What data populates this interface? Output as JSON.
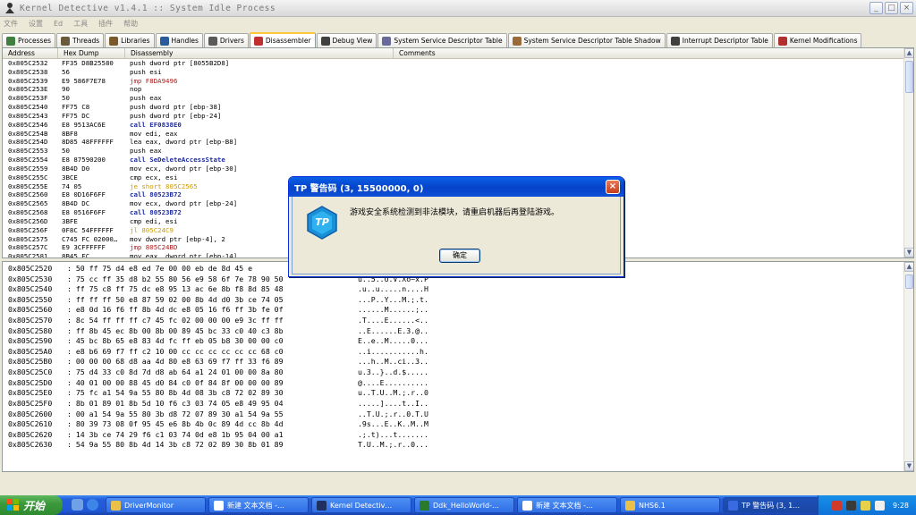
{
  "window": {
    "title": "Kernel Detective v1.4.1 :: System Idle Process",
    "controls": [
      "_",
      "□",
      "×"
    ]
  },
  "menu": [
    "文件",
    "设置",
    "Ed",
    "工具",
    "插件",
    "帮助"
  ],
  "tabs": [
    {
      "label": "Processes",
      "icon": "gear-icon",
      "color": "#3f7f3f"
    },
    {
      "label": "Threads",
      "icon": "threads-icon",
      "color": "#6b5a3a"
    },
    {
      "label": "Libraries",
      "icon": "library-icon",
      "color": "#7a5a2a"
    },
    {
      "label": "Handles",
      "icon": "handles-icon",
      "color": "#2a5a9a"
    },
    {
      "label": "Drivers",
      "icon": "driver-icon",
      "color": "#5a5a5a"
    },
    {
      "label": "Disassembler",
      "icon": "disassembler-icon",
      "color": "#c03030",
      "active": true
    },
    {
      "label": "Debug View",
      "icon": "debug-icon",
      "color": "#404040"
    },
    {
      "label": "System Service Descriptor Table",
      "icon": "wrench-icon",
      "color": "#6a6a9a"
    },
    {
      "label": "System Service Descriptor Table Shadow",
      "icon": "wrench-icon",
      "color": "#9a6a3a"
    },
    {
      "label": "Interrupt Descriptor Table",
      "icon": "keyboard-icon",
      "color": "#404040"
    },
    {
      "label": "Kernel Modifications",
      "icon": "shield-icon",
      "color": "#b03030"
    }
  ],
  "disasm": {
    "headers": [
      "Address",
      "Hex Dump",
      "Disassembly",
      "Comments"
    ],
    "rows": [
      {
        "addr": "0x805C2532",
        "hex": "FF35 D8B25580",
        "dis": "push dword ptr [8055B2D8]",
        "kind": ""
      },
      {
        "addr": "0x805C2538",
        "hex": "56",
        "dis": "push esi",
        "kind": ""
      },
      {
        "addr": "0x805C2539",
        "hex": "E9 586F7E78",
        "dis": "jmp F8DA9496",
        "kind": "jmp"
      },
      {
        "addr": "0x805C253E",
        "hex": "90",
        "dis": "nop",
        "kind": ""
      },
      {
        "addr": "0x805C253F",
        "hex": "50",
        "dis": "push eax",
        "kind": ""
      },
      {
        "addr": "0x805C2540",
        "hex": "FF75 C8",
        "dis": "push dword ptr [ebp-38]",
        "kind": ""
      },
      {
        "addr": "0x805C2543",
        "hex": "FF75 DC",
        "dis": "push dword ptr [ebp-24]",
        "kind": ""
      },
      {
        "addr": "0x805C2546",
        "hex": "E8 9513AC6E",
        "dis": "call EF0838E0",
        "kind": "call"
      },
      {
        "addr": "0x805C254B",
        "hex": "8BF8",
        "dis": "mov edi, eax",
        "kind": ""
      },
      {
        "addr": "0x805C254D",
        "hex": "8D85 48FFFFFF",
        "dis": "lea eax, dword ptr [ebp-B8]",
        "kind": ""
      },
      {
        "addr": "0x805C2553",
        "hex": "50",
        "dis": "push eax",
        "kind": ""
      },
      {
        "addr": "0x805C2554",
        "hex": "E8 87590200",
        "dis": "call SeDeleteAccessState",
        "kind": "call"
      },
      {
        "addr": "0x805C2559",
        "hex": "8B4D D0",
        "dis": "mov ecx, dword ptr [ebp-30]",
        "kind": ""
      },
      {
        "addr": "0x805C255C",
        "hex": "3BCE",
        "dis": "cmp ecx, esi",
        "kind": ""
      },
      {
        "addr": "0x805C255E",
        "hex": "74 05",
        "dis": "je short 805C2565",
        "kind": "jcc"
      },
      {
        "addr": "0x805C2560",
        "hex": "E8 0D16F6FF",
        "dis": "call 80523B72",
        "kind": "call"
      },
      {
        "addr": "0x805C2565",
        "hex": "8B4D DC",
        "dis": "mov ecx, dword ptr [ebp-24]",
        "kind": ""
      },
      {
        "addr": "0x805C2568",
        "hex": "E8 0516F6FF",
        "dis": "call 80523B72",
        "kind": "call"
      },
      {
        "addr": "0x805C256D",
        "hex": "3BFE",
        "dis": "cmp edi, esi",
        "kind": ""
      },
      {
        "addr": "0x805C256F",
        "hex": "0F8C 54FFFFFF",
        "dis": "jl 805C24C9",
        "kind": "jcc"
      },
      {
        "addr": "0x805C2575",
        "hex": "C745 FC 02000…",
        "dis": "mov dword ptr [ebp-4], 2",
        "kind": ""
      },
      {
        "addr": "0x805C257C",
        "hex": "E9 3CFFFFFF",
        "dis": "jmp 805C24BD",
        "kind": "jmp"
      },
      {
        "addr": "0x805C2581",
        "hex": "8B45 FC",
        "dis": "mov eax, dword ptr [ebp-14]",
        "kind": ""
      }
    ]
  },
  "hexdump": [
    {
      "addr": "0x805C2520",
      "bytes": ": 50 ff 75 d4 e8 ed 7e 00 00 eb de 8d 45 e",
      "ascii": ""
    },
    {
      "addr": "0x805C2530",
      "bytes": ": 75 cc ff 35 d8 b2 55 80 56 e9 58 6f 7e 78 90 50",
      "ascii": "u..5..U.V.Xo~x.P"
    },
    {
      "addr": "0x805C2540",
      "bytes": ": ff 75 c8 ff 75 dc e8 95 13 ac 6e 8b f8 8d 85 48",
      "ascii": ".u..u.....n....H"
    },
    {
      "addr": "0x805C2550",
      "bytes": ": ff ff ff 50 e8 87 59 02 00 8b 4d d0 3b ce 74 05",
      "ascii": "...P..Y...M.;.t."
    },
    {
      "addr": "0x805C2560",
      "bytes": ": e8 0d 16 f6 ff 8b 4d dc e8 05 16 f6 ff 3b fe 0f",
      "ascii": "......M......;.."
    },
    {
      "addr": "0x805C2570",
      "bytes": ": 8c 54 ff ff ff c7 45 fc 02 00 00 00 e9 3c ff ff",
      "ascii": ".T....E......<.."
    },
    {
      "addr": "0x805C2580",
      "bytes": ": ff 8b 45 ec 8b 00 8b 00 89 45 bc 33 c0 40 c3 8b",
      "ascii": "..E......E.3.@.."
    },
    {
      "addr": "0x805C2590",
      "bytes": ": 45 bc 8b 65 e8 83 4d fc ff eb 05 b8 30 00 00 c0",
      "ascii": "E..e..M.....0..."
    },
    {
      "addr": "0x805C25A0",
      "bytes": ": e8 b6 69 f7 ff c2 10 00 cc cc cc cc cc cc 68 c0",
      "ascii": "..i...........h."
    },
    {
      "addr": "0x805C25B0",
      "bytes": ": 00 00 00 68 d8 aa 4d 80 e8 63 69 f7 ff 33 f6 89",
      "ascii": "...h..M..ci..3.."
    },
    {
      "addr": "0x805C25C0",
      "bytes": ": 75 d4 33 c0 8d 7d d8 ab 64 a1 24 01 00 00 8a 80",
      "ascii": "u.3..}..d.$....."
    },
    {
      "addr": "0x805C25D0",
      "bytes": ": 40 01 00 00 88 45 d0 84 c0 0f 84 8f 00 00 00 89",
      "ascii": "@....E.........."
    },
    {
      "addr": "0x805C25E0",
      "bytes": ": 75 fc a1 54 9a 55 80 8b 4d 08 3b c8 72 02 89 30",
      "ascii": "u..T.U..M.;.r..0"
    },
    {
      "addr": "0x805C25F0",
      "bytes": ": 8b 01 89 01 8b 5d 10 f6 c3 03 74 05 e8 49 95 04",
      "ascii": ".....]....t..I.."
    },
    {
      "addr": "0x805C2600",
      "bytes": ": 00 a1 54 9a 55 80 3b d8 72 07 89 30 a1 54 9a 55",
      "ascii": "..T.U.;.r..0.T.U"
    },
    {
      "addr": "0x805C2610",
      "bytes": ": 80 39 73 08 0f 95 45 e6 8b 4b 0c 89 4d cc 8b 4d",
      "ascii": ".9s...E..K..M..M"
    },
    {
      "addr": "0x805C2620",
      "bytes": ": 14 3b ce 74 29 f6 c1 03 74 0d e8 1b 95 04 00 a1",
      "ascii": ".;.t)...t......."
    },
    {
      "addr": "0x805C2630",
      "bytes": ": 54 9a 55 80 8b 4d 14 3b c8 72 02 89 30 8b 01 89",
      "ascii": "T.U..M.;.r..0..."
    }
  ],
  "dialog": {
    "title": "TP 警告码 (3, 15500000, 0)",
    "message": "游戏安全系统检测到非法模块，请重启机器后再登陆游戏。",
    "ok_label": "确定",
    "logo_text": "TP"
  },
  "taskbar": {
    "start_label": "开始",
    "tasks": [
      {
        "label": "DriverMonitor",
        "icon_color": "#e8c04a"
      },
      {
        "label": "新建 文本文档 -…",
        "icon_color": "#ffffff"
      },
      {
        "label": "Kernel Detectiv…",
        "icon_color": "#203060"
      },
      {
        "label": "Ddk_HelloWorld-…",
        "icon_color": "#2a7a2a"
      },
      {
        "label": "新建 文本文档 -…",
        "icon_color": "#ffffff"
      },
      {
        "label": "NHS6.1",
        "icon_color": "#e8c04a"
      },
      {
        "label": "TP 警告码 (3, 1…",
        "icon_color": "#3a6adf",
        "active": true
      }
    ],
    "clock": "9:28"
  }
}
